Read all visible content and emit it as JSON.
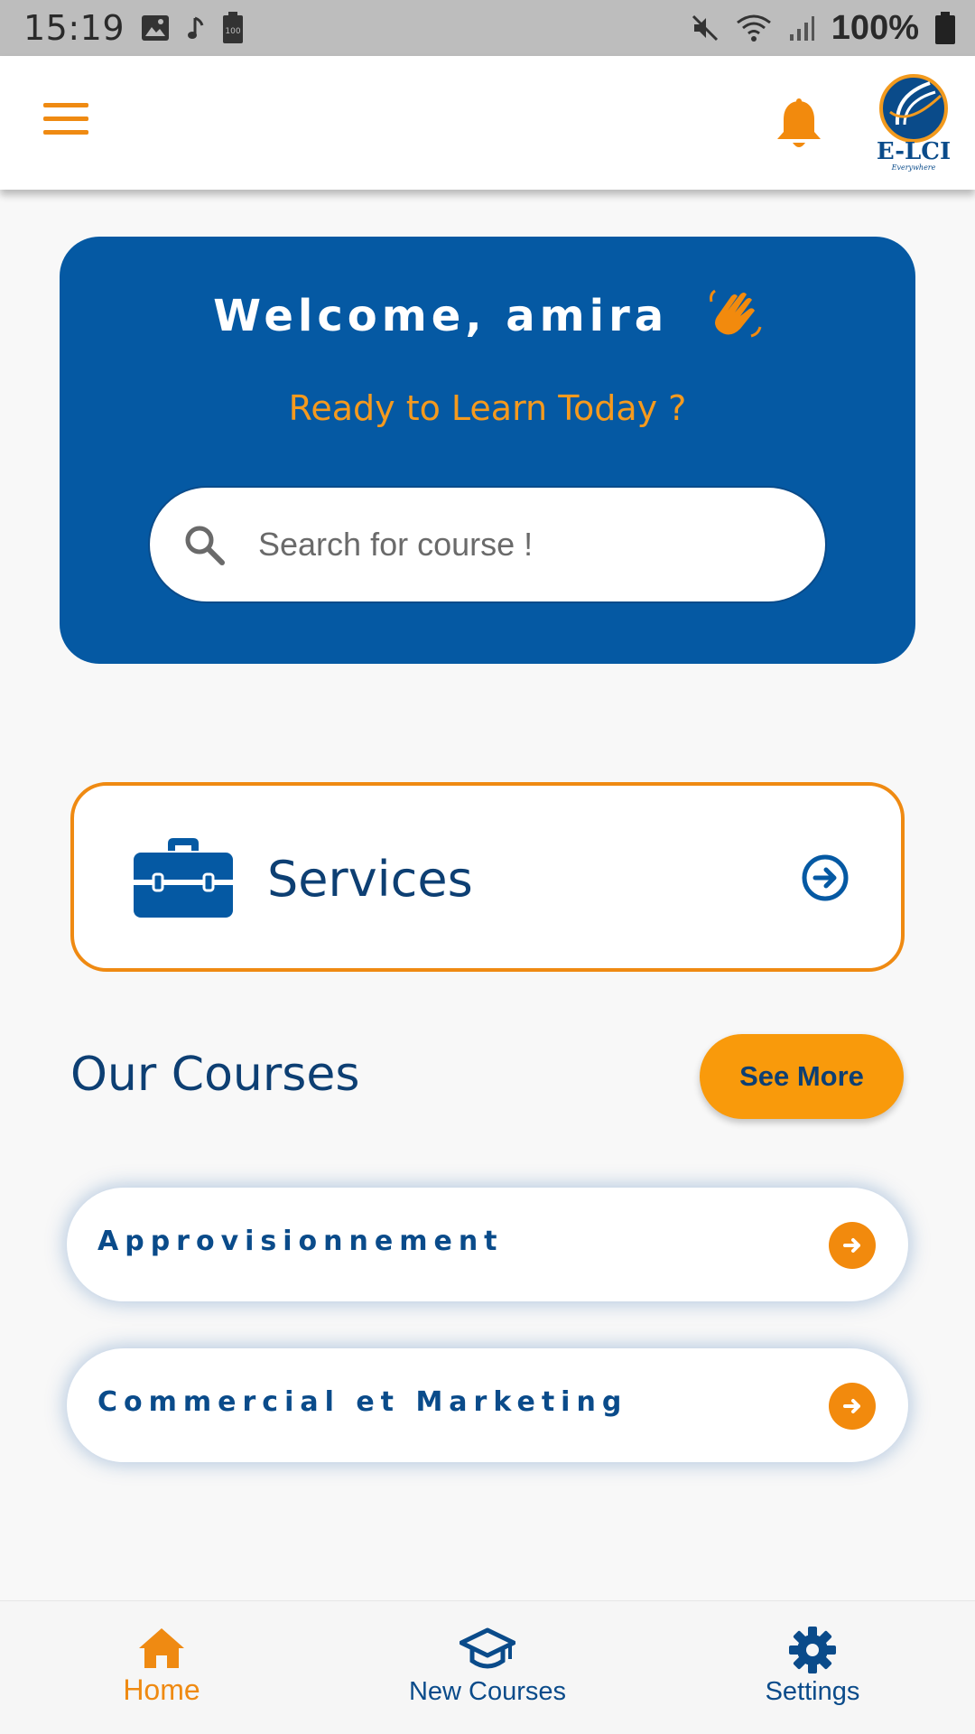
{
  "status_bar": {
    "time": "15:19",
    "battery_text": "100%",
    "icons": [
      "image-icon",
      "music-note-icon",
      "battery-saver-icon",
      "mute-icon",
      "wifi-icon",
      "signal-icon",
      "battery-icon"
    ]
  },
  "app_bar": {
    "menu_icon": "hamburger-menu-icon",
    "notification_icon": "bell-icon",
    "logo_text": "E-LCI",
    "logo_tagline": "Everywhere"
  },
  "welcome": {
    "title": "Welcome, amira",
    "wave_icon": "waving-hand-icon",
    "subtitle": "Ready to Learn Today ?",
    "search": {
      "placeholder": "Search for course !",
      "value": ""
    }
  },
  "services": {
    "label": "Services",
    "icon": "briefcase-icon",
    "arrow_icon": "circle-arrow-right-icon"
  },
  "courses": {
    "title": "Our Courses",
    "see_more_label": "See More",
    "items": [
      {
        "label": "Approvisionnement"
      },
      {
        "label": "Commercial et Marketing"
      }
    ]
  },
  "bottom_nav": {
    "items": [
      {
        "label": "Home",
        "icon": "home-icon",
        "active": true
      },
      {
        "label": "New Courses",
        "icon": "graduation-cap-icon",
        "active": false
      },
      {
        "label": "Settings",
        "icon": "gear-icon",
        "active": false
      }
    ]
  },
  "colors": {
    "primary_blue": "#0559a3",
    "dark_blue": "#0d3f73",
    "accent_orange": "#ef8a12",
    "button_orange": "#f99a0b",
    "background": "#f8f8f8"
  }
}
